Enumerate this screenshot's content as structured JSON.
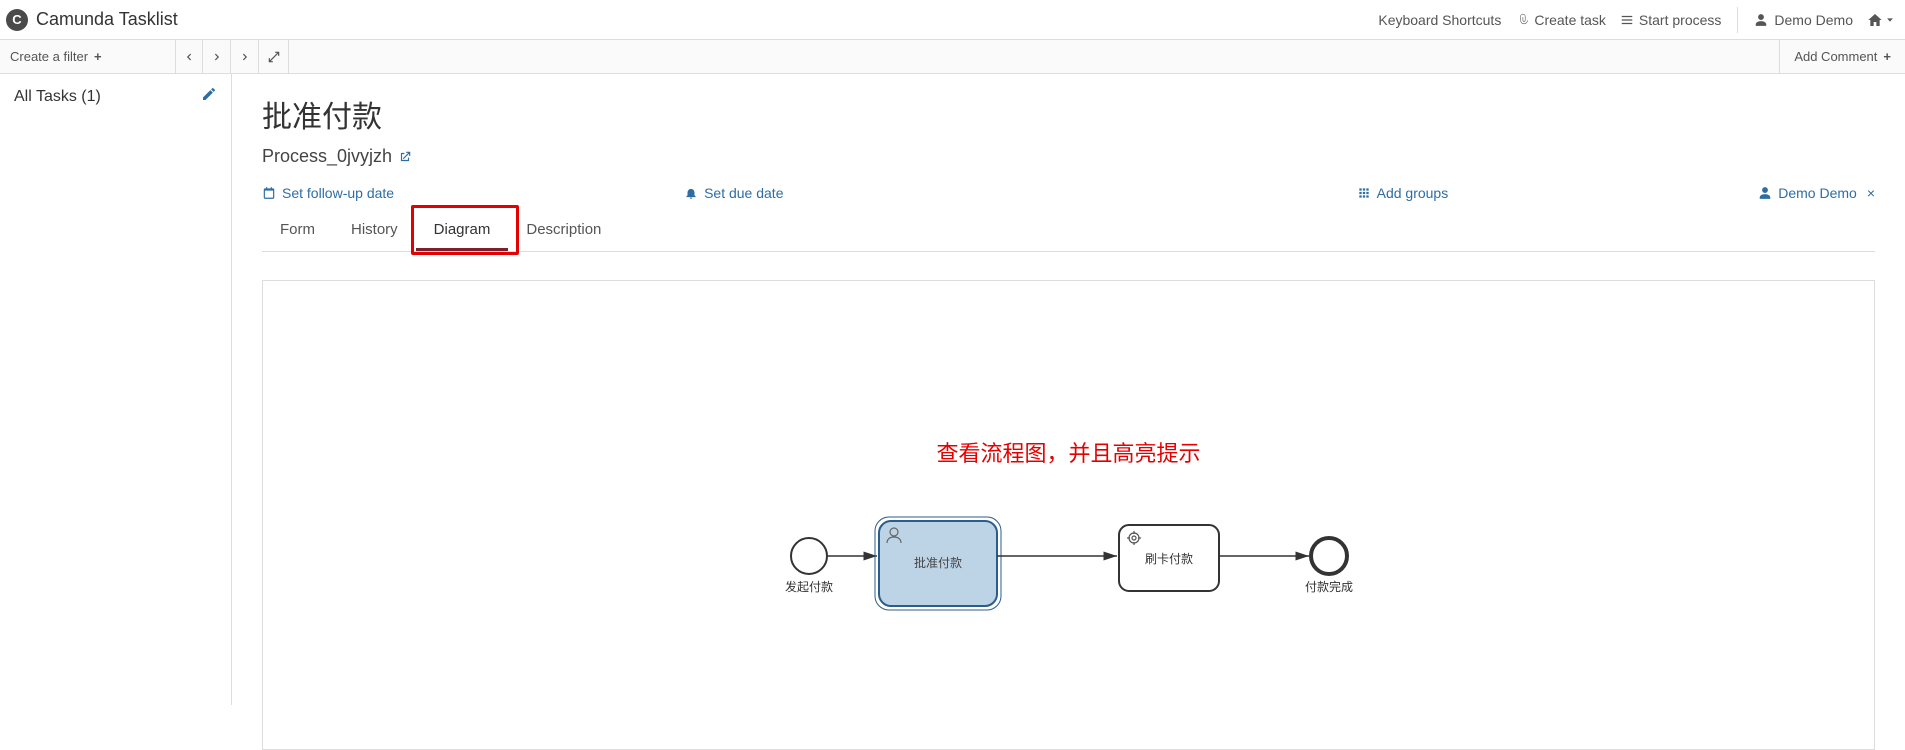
{
  "brand": {
    "logo_letter": "C",
    "title": "Camunda Tasklist"
  },
  "topbar": {
    "keyboard_shortcuts": "Keyboard Shortcuts",
    "create_task": "Create task",
    "start_process": "Start process",
    "user": "Demo Demo"
  },
  "secondbar": {
    "create_filter": "Create a filter",
    "add_comment": "Add Comment"
  },
  "sidebar": {
    "all_tasks_label": "All Tasks (1)"
  },
  "task": {
    "title": "批准付款",
    "process_name": "Process_0jvyjzh"
  },
  "actions": {
    "set_followup": "Set follow-up date",
    "set_due": "Set due date",
    "add_groups": "Add groups",
    "assignee": "Demo Demo"
  },
  "tabs": {
    "form": "Form",
    "history": "History",
    "diagram": "Diagram",
    "description": "Description"
  },
  "annotation_text": "查看流程图，并且高亮提示",
  "diagram": {
    "start_label": "发起付款",
    "usertask_label": "批准付款",
    "servicetask_label": "刷卡付款",
    "end_label": "付款完成"
  }
}
